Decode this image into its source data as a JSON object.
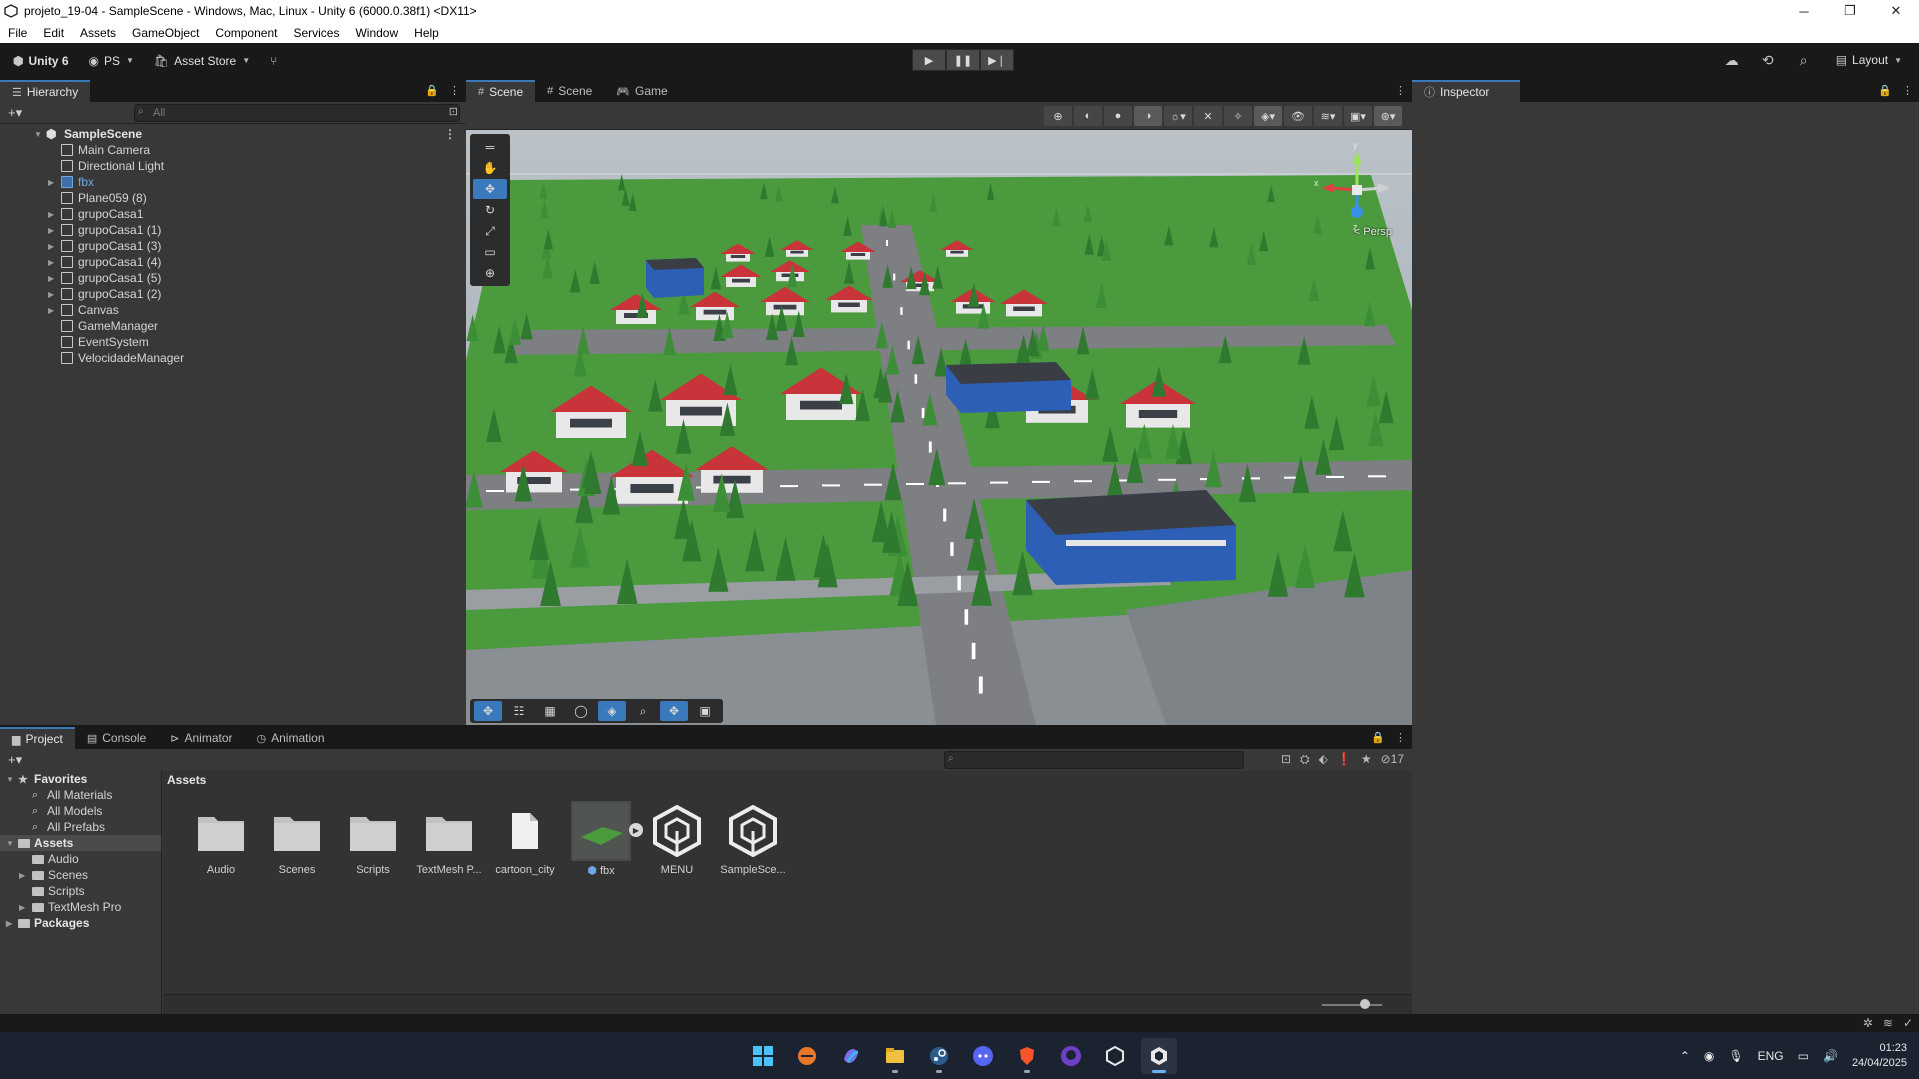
{
  "window": {
    "title": "projeto_19-04 - SampleScene - Windows, Mac, Linux - Unity 6 (6000.0.38f1) <DX11>",
    "minimize": "─",
    "restore": "❐",
    "close": "✕"
  },
  "menu": [
    "File",
    "Edit",
    "Assets",
    "GameObject",
    "Component",
    "Services",
    "Window",
    "Help"
  ],
  "toolbar": {
    "account": "Unity 6",
    "ps_label": "PS",
    "asset_store": "Asset Store",
    "layout_label": "Layout"
  },
  "hierarchy": {
    "tab": "Hierarchy",
    "search_placeholder": "All",
    "scene": "SampleScene",
    "items": [
      {
        "label": "Main Camera",
        "expandable": false
      },
      {
        "label": "Directional Light",
        "expandable": false
      },
      {
        "label": "fbx",
        "expandable": true,
        "prefab": true
      },
      {
        "label": "Plane059 (8)",
        "expandable": false
      },
      {
        "label": "grupoCasa1",
        "expandable": true
      },
      {
        "label": "grupoCasa1 (1)",
        "expandable": true
      },
      {
        "label": "grupoCasa1 (3)",
        "expandable": true
      },
      {
        "label": "grupoCasa1 (4)",
        "expandable": true
      },
      {
        "label": "grupoCasa1 (5)",
        "expandable": true
      },
      {
        "label": "grupoCasa1 (2)",
        "expandable": true
      },
      {
        "label": "Canvas",
        "expandable": true
      },
      {
        "label": "GameManager",
        "expandable": false
      },
      {
        "label": "EventSystem",
        "expandable": false
      },
      {
        "label": "VelocidadeManager",
        "expandable": false
      }
    ]
  },
  "scene_tabs": {
    "tab1": "Scene",
    "tab2": "Scene",
    "tab3": "Game"
  },
  "scene": {
    "persp_label": "< Persp",
    "gizmo_axes": {
      "x": "x",
      "y": "y",
      "z": "z"
    }
  },
  "inspector": {
    "tab": "Inspector"
  },
  "project_tabs": {
    "project": "Project",
    "console": "Console",
    "animator": "Animator",
    "animation": "Animation"
  },
  "project": {
    "hidden_count": "17",
    "favorites_header": "Favorites",
    "favorites": [
      "All Materials",
      "All Models",
      "All Prefabs"
    ],
    "assets_header": "Assets",
    "asset_folders": [
      {
        "label": "Audio",
        "expandable": false
      },
      {
        "label": "Scenes",
        "expandable": true
      },
      {
        "label": "Scripts",
        "expandable": false
      },
      {
        "label": "TextMesh Pro",
        "expandable": true
      }
    ],
    "packages_header": "Packages",
    "breadcrumb": "Assets",
    "assets": [
      {
        "name": "Audio",
        "kind": "folder"
      },
      {
        "name": "Scenes",
        "kind": "folder"
      },
      {
        "name": "Scripts",
        "kind": "folder"
      },
      {
        "name": "TextMesh P...",
        "kind": "folder"
      },
      {
        "name": "cartoon_city",
        "kind": "file"
      },
      {
        "name": "fbx",
        "kind": "model"
      },
      {
        "name": "MENU",
        "kind": "unity-scene"
      },
      {
        "name": "SampleSce...",
        "kind": "unity-scene"
      }
    ]
  },
  "taskbar": {
    "language": "ENG",
    "time": "01:23",
    "date": "24/04/2025"
  },
  "colors": {
    "accent": "#3a79bb",
    "panel": "#383838",
    "toolbar": "#191919",
    "grass": "#4a9a3c",
    "roof": "#c8343a",
    "building": "#2c5fb5"
  }
}
